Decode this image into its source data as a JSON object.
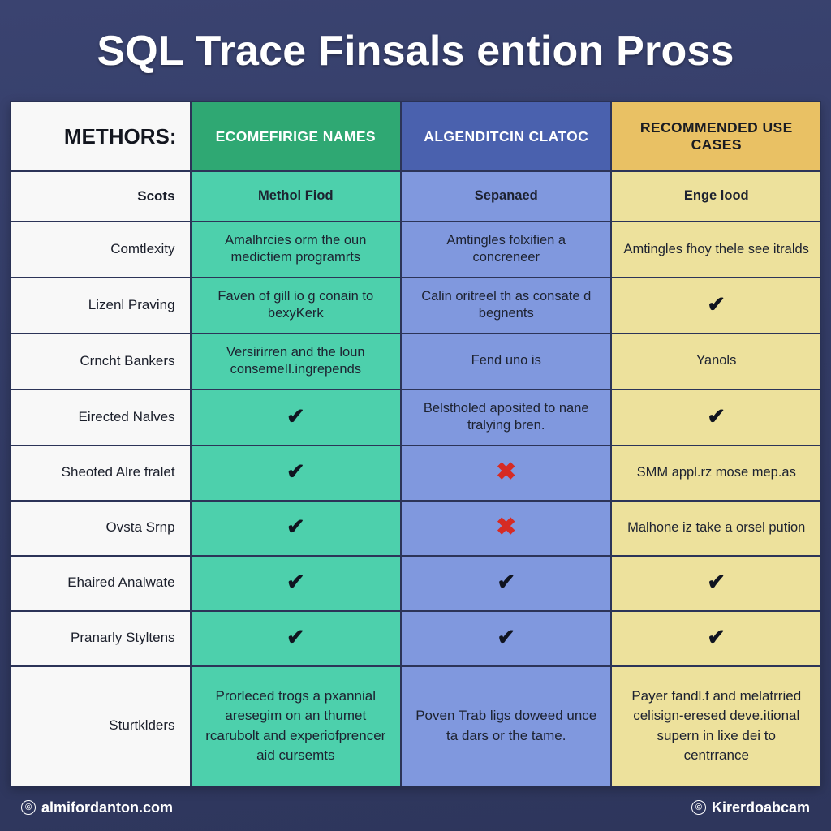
{
  "title": "SQL Trace Finsals ention Pross",
  "table": {
    "headers": [
      {
        "label": "METHORS:",
        "style": "methods"
      },
      {
        "label": "ECOMEFIRIGE NAMES",
        "style": "green"
      },
      {
        "label": "ALGENDITCIN CLATOC",
        "style": "blue"
      },
      {
        "label": "RECOMMENDED USE CASES",
        "style": "yellow"
      }
    ],
    "rows": [
      {
        "type": "sub",
        "label": "Scots",
        "green": "Methol Fiod",
        "blue": "Sepanaed",
        "yellow": "Enge lood"
      },
      {
        "type": "std",
        "label": "Comtlexity",
        "green": "Amalhrcies orm the oun medictiem programrts",
        "blue": "Amtingles folxifien a concreneer",
        "yellow": "Amtingles fhoy thele see itralds"
      },
      {
        "type": "std",
        "label": "Lizenl Praving",
        "green": "Faven of gill io g conain to bexyKerk",
        "blue": "Calin oritreel th as consate d begnents",
        "yellow": "check"
      },
      {
        "type": "std",
        "label": "Crncht Bankers",
        "green": "Versirirren and the loun consemeIl.ingrepends",
        "blue": "Fend uno is",
        "yellow": "Yanols"
      },
      {
        "type": "std",
        "label": "Eirected Nalves",
        "green": "check",
        "blue": "Belstholed aposited to nane tralying bren.",
        "yellow": "check"
      },
      {
        "type": "std",
        "label": "Sheoted Alre fralet",
        "green": "check",
        "blue": "cross",
        "yellow": "SMM appl.rz mose mep.as"
      },
      {
        "type": "std",
        "label": "Ovsta Srnp",
        "green": "check",
        "blue": "cross",
        "yellow": "Malhone iz take a orsel pution"
      },
      {
        "type": "std",
        "label": "Ehaired Analwate",
        "green": "check",
        "blue": "check",
        "yellow": "check"
      },
      {
        "type": "std",
        "label": "Pranarly Styltens",
        "green": "check",
        "blue": "check",
        "yellow": "check"
      },
      {
        "type": "tall",
        "label": "Sturtklders",
        "green": "Prorleced trogs a pxannial aresegim on an thumet rcarubolt and experiofprencer aid cursemts",
        "blue": "Poven Trab ligs doweed unce ta dars or the tame.",
        "yellow": "Payer fandl.f and melatrried celisign-eresed deve.itional supern in lixe dei to centrrance"
      }
    ]
  },
  "footer": {
    "left_label": "almifordanton.com",
    "left_mark": "©",
    "right_label": "Kirerdoabcam",
    "right_mark": "©"
  },
  "colors": {
    "background": "#333c66",
    "header_green": "#2fa873",
    "header_blue": "#4a61ae",
    "header_yellow": "#e9c164",
    "cell_green": "#4dd0ac",
    "cell_blue": "#8098de",
    "cell_yellow": "#ede19c",
    "cell_white": "#f8f8f8",
    "check_mark": "#101420",
    "cross_mark": "#d62b24"
  },
  "icons": {
    "check": "✔",
    "cross": "✖"
  }
}
